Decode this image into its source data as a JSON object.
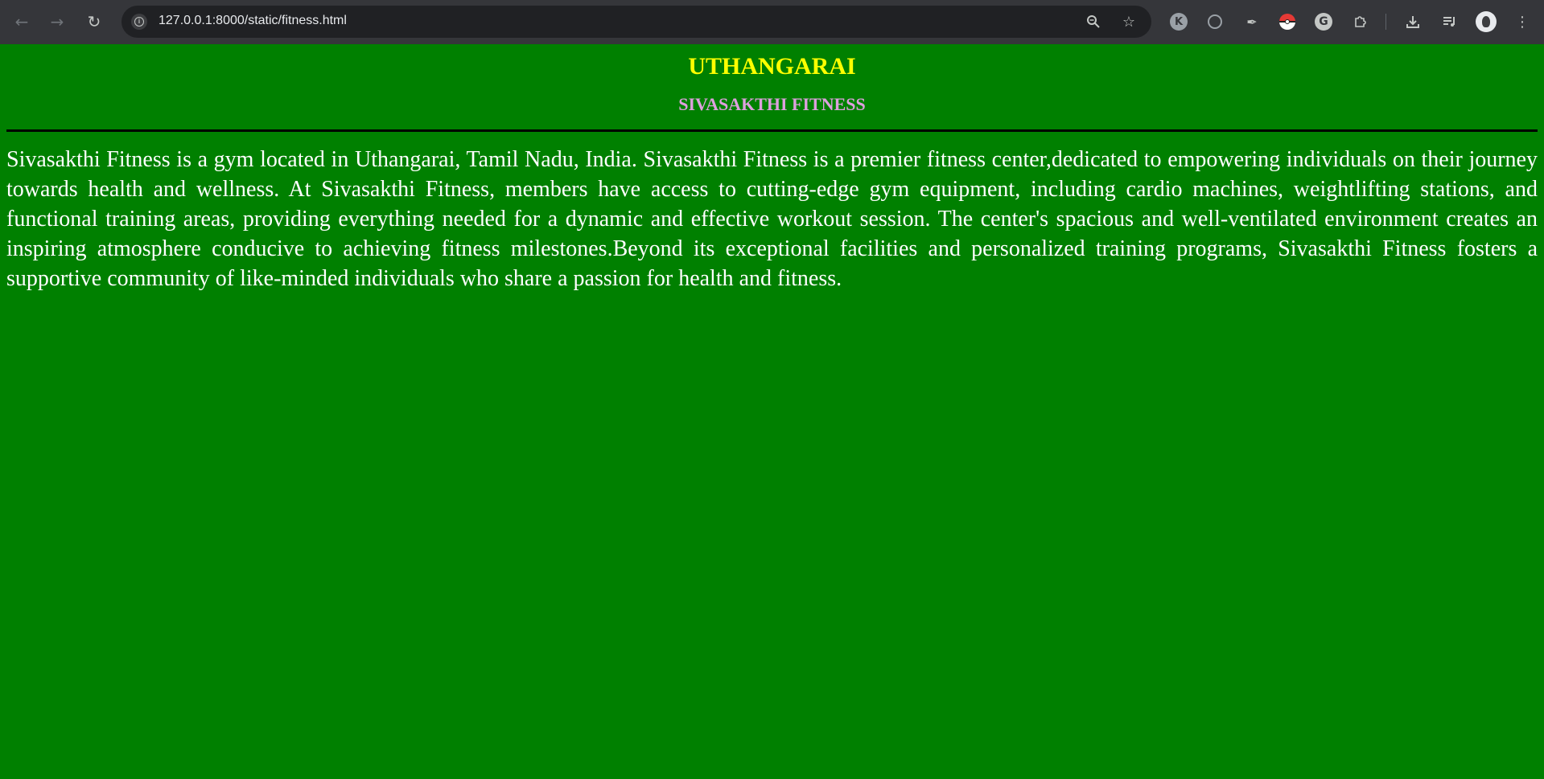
{
  "browser": {
    "url": "127.0.0.1:8000/static/fitness.html",
    "icons": {
      "back": "arrow-left-icon",
      "forward": "arrow-right-icon",
      "reload": "reload-icon",
      "info": "info-icon",
      "zoom": "zoom-icon",
      "bookmark": "star-icon",
      "extension_k": "K",
      "extension_g": "G",
      "menu": "kebab-menu-icon"
    }
  },
  "page": {
    "title": "UTHANGARAI",
    "subtitle": "SIVASAKTHI FITNESS",
    "paragraph": "Sivasakthi Fitness is a gym located in Uthangarai, Tamil Nadu, India. Sivasakthi Fitness is a premier fitness center,dedicated to empowering individuals on their journey towards health and wellness. At Sivasakthi Fitness, members have access to cutting-edge gym equipment, including cardio machines, weightlifting stations, and functional training areas, providing everything needed for a dynamic and effective workout session. The center's spacious and well-ventilated environment creates an inspiring atmosphere conducive to achieving fitness milestones.Beyond its exceptional facilities and personalized training programs, Sivasakthi Fitness fosters a supportive community of like-minded individuals who share a passion for health and fitness.",
    "colors": {
      "background": "#008000",
      "title": "#ffff00",
      "subtitle": "#dda0dd",
      "text": "#ffffff",
      "rule": "#000000"
    }
  }
}
